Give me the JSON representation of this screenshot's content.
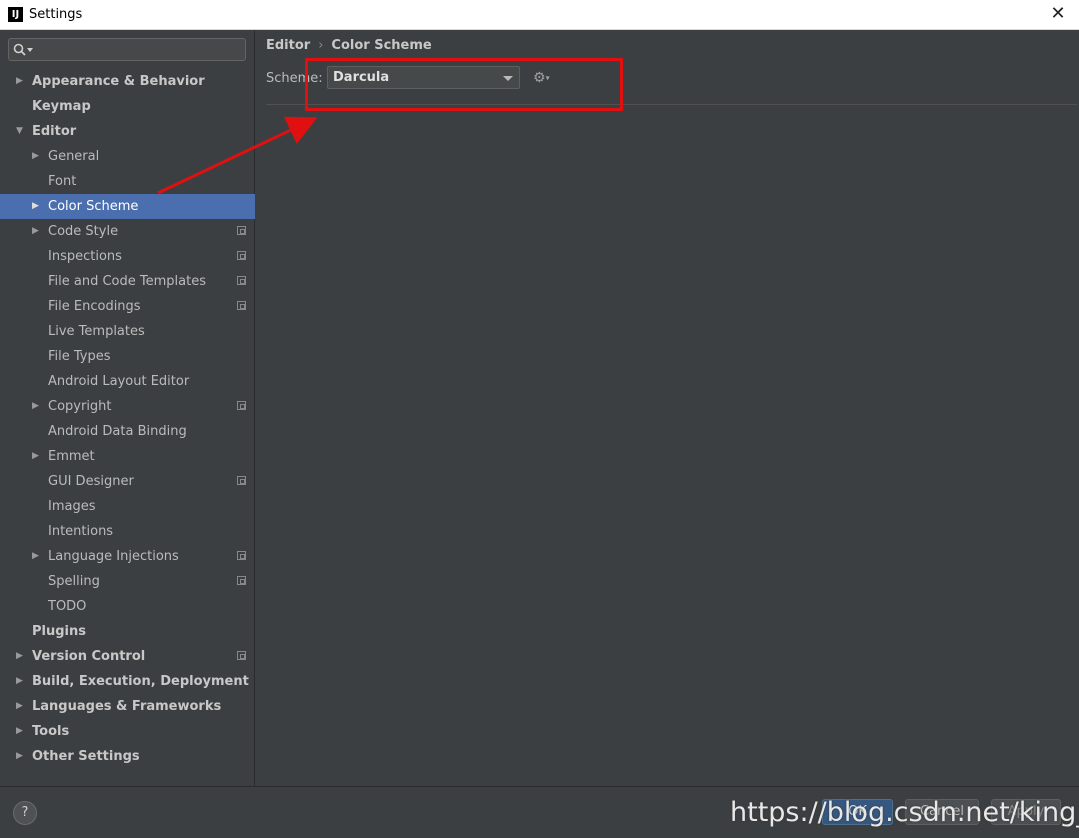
{
  "window": {
    "title": "Settings",
    "app_icon_text": "IJ",
    "close_glyph": "✕"
  },
  "sidebar": {
    "search": {
      "placeholder": "",
      "icon": "search-icon"
    },
    "items": [
      {
        "label": "Appearance & Behavior",
        "level": 0,
        "arrow": "▶",
        "bold": true
      },
      {
        "label": "Keymap",
        "level": 0,
        "arrow": "",
        "bold": true
      },
      {
        "label": "Editor",
        "level": 0,
        "arrow": "▼",
        "bold": true
      },
      {
        "label": "General",
        "level": 1,
        "arrow": "▶"
      },
      {
        "label": "Font",
        "level": 1,
        "arrow": ""
      },
      {
        "label": "Color Scheme",
        "level": 1,
        "arrow": "▶",
        "selected": true
      },
      {
        "label": "Code Style",
        "level": 1,
        "arrow": "▶",
        "project": true
      },
      {
        "label": "Inspections",
        "level": 1,
        "arrow": "",
        "project": true
      },
      {
        "label": "File and Code Templates",
        "level": 1,
        "arrow": "",
        "project": true
      },
      {
        "label": "File Encodings",
        "level": 1,
        "arrow": "",
        "project": true
      },
      {
        "label": "Live Templates",
        "level": 1,
        "arrow": ""
      },
      {
        "label": "File Types",
        "level": 1,
        "arrow": ""
      },
      {
        "label": "Android Layout Editor",
        "level": 1,
        "arrow": ""
      },
      {
        "label": "Copyright",
        "level": 1,
        "arrow": "▶",
        "project": true
      },
      {
        "label": "Android Data Binding",
        "level": 1,
        "arrow": ""
      },
      {
        "label": "Emmet",
        "level": 1,
        "arrow": "▶"
      },
      {
        "label": "GUI Designer",
        "level": 1,
        "arrow": "",
        "project": true
      },
      {
        "label": "Images",
        "level": 1,
        "arrow": ""
      },
      {
        "label": "Intentions",
        "level": 1,
        "arrow": ""
      },
      {
        "label": "Language Injections",
        "level": 1,
        "arrow": "▶",
        "project": true
      },
      {
        "label": "Spelling",
        "level": 1,
        "arrow": "",
        "project": true
      },
      {
        "label": "TODO",
        "level": 1,
        "arrow": ""
      },
      {
        "label": "Plugins",
        "level": 0,
        "arrow": "",
        "bold": true
      },
      {
        "label": "Version Control",
        "level": 0,
        "arrow": "▶",
        "bold": true,
        "project": true
      },
      {
        "label": "Build, Execution, Deployment",
        "level": 0,
        "arrow": "▶",
        "bold": true
      },
      {
        "label": "Languages & Frameworks",
        "level": 0,
        "arrow": "▶",
        "bold": true
      },
      {
        "label": "Tools",
        "level": 0,
        "arrow": "▶",
        "bold": true
      },
      {
        "label": "Other Settings",
        "level": 0,
        "arrow": "▶",
        "bold": true
      }
    ]
  },
  "main": {
    "breadcrumb": {
      "parent": "Editor",
      "separator": "›",
      "current": "Color Scheme"
    },
    "scheme": {
      "label": "Scheme:",
      "value": "Darcula"
    },
    "gear_glyph": "⚙",
    "gear_caret": "▾"
  },
  "footer": {
    "help": "?",
    "ok": "OK",
    "cancel": "Cancel",
    "apply": "Apply"
  },
  "watermark": "https://blog.csdn.net/king_qc",
  "colors": {
    "selection": "#4b6eaf",
    "annotation": "#e01010",
    "background": "#3c3f41"
  }
}
